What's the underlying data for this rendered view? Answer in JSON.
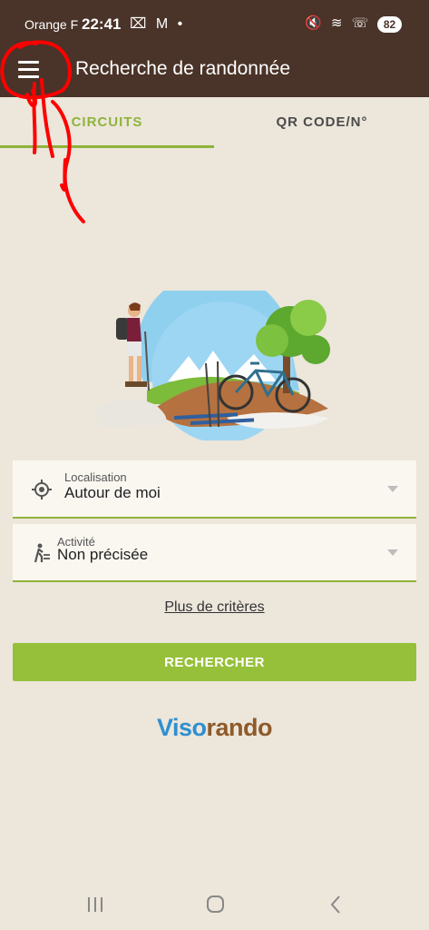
{
  "status_bar": {
    "carrier": "Orange F",
    "time": "22:41",
    "notification_icons": "⌧ M •",
    "system_icons": "🔇 ≋ ☏ .ıl",
    "battery": "82"
  },
  "app_bar": {
    "title": "Recherche de randonnée",
    "menu_icon": "hamburger-menu-icon"
  },
  "tabs": [
    {
      "label": "CIRCUITS",
      "active": true
    },
    {
      "label": "QR CODE/N°",
      "active": false
    }
  ],
  "form": {
    "location": {
      "label": "Localisation",
      "value": "Autour de moi",
      "icon": "crosshair-location-icon"
    },
    "activity": {
      "label": "Activité",
      "value": "Non précisée",
      "icon": "hiker-icon"
    },
    "more_criteria": "Plus de critères",
    "search_button": "RECHERCHER"
  },
  "brand": {
    "part1": "Viso",
    "part2": "rando",
    "color1": "#2f8fcf",
    "color2": "#8e5a2a"
  },
  "colors": {
    "header": "#4a3328",
    "accent": "#8fb43a",
    "background": "#ece6db",
    "annotation": "#ff0000"
  }
}
